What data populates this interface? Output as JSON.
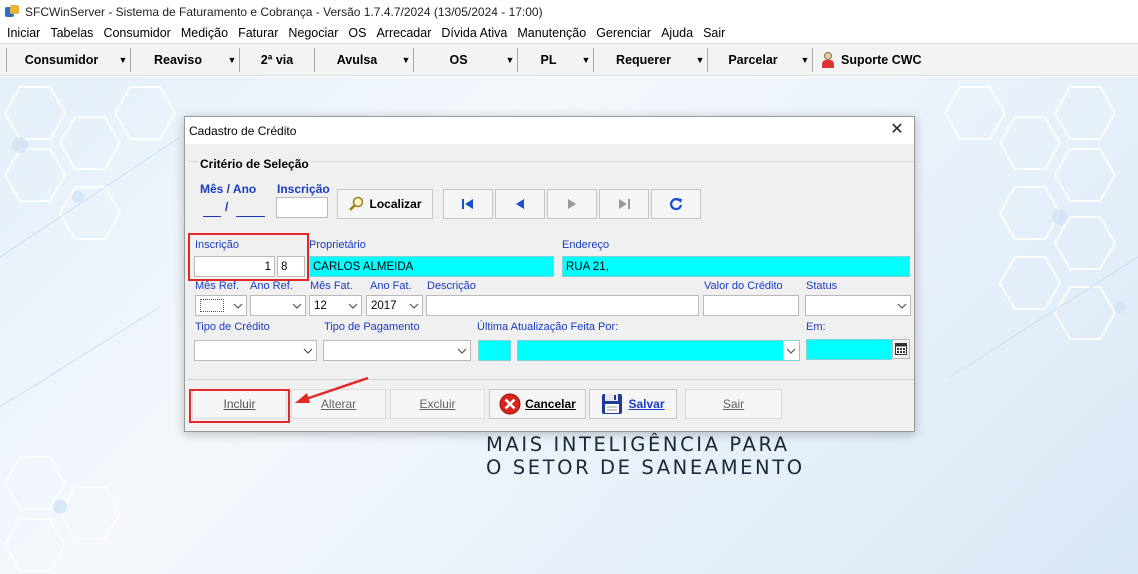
{
  "window": {
    "title": "SFCWinServer - Sistema de Faturamento e Cobrança - Versão 1.7.4.7/2024 (13/05/2024 - 17:00)"
  },
  "menu": [
    "Iniciar",
    "Tabelas",
    "Consumidor",
    "Medição",
    "Faturar",
    "Negociar",
    "OS",
    "Arrecadar",
    "Dívida Ativa",
    "Manutenção",
    "Gerenciar",
    "Ajuda",
    "Sair"
  ],
  "toolbar": {
    "buttons": [
      "Consumidor",
      "Reaviso",
      "2ª via",
      "Avulsa",
      "OS",
      "PL",
      "Requerer",
      "Parcelar"
    ],
    "support": "Suporte CWC"
  },
  "slogan": {
    "line1": "MAIS INTELIGÊNCIA PARA",
    "line2": "O SETOR DE SANEAMENTO"
  },
  "dialog": {
    "title": "Cadastro de Crédito",
    "criteria": {
      "legend": "Critério de Seleção",
      "mes_ano_label": "Mês / Ano",
      "slash": "/",
      "inscricao_label": "Inscrição",
      "localizar": "Localizar"
    },
    "form": {
      "inscricao_label": "Inscrição",
      "inscricao_value": "1",
      "inscricao_dv": "8",
      "proprietario_label": "Proprietário",
      "proprietario_value": "CARLOS ALMEIDA",
      "endereco_label": "Endereço",
      "endereco_value": "RUA 21,",
      "mes_ref_label": "Mês Ref.",
      "ano_ref_label": "Ano Ref.",
      "mes_fat_label": "Mês Fat.",
      "mes_fat_value": "12",
      "ano_fat_label": "Ano Fat.",
      "ano_fat_value": "2017",
      "descricao_label": "Descrição",
      "valor_credito_label": "Valor do Crédito",
      "status_label": "Status",
      "tipo_credito_label": "Tipo de Crédito",
      "tipo_pagamento_label": "Tipo de Pagamento",
      "ultima_atualizacao_label": "Última Atualização Feita Por:",
      "em_label": "Em:"
    },
    "actions": {
      "incluir": "Incluir",
      "alterar": "Alterar",
      "excluir": "Excluir",
      "cancelar": "Cancelar",
      "salvar": "Salvar",
      "sair": "Sair"
    }
  },
  "colors": {
    "highlight": "#00ffff",
    "annotation": "#e32828",
    "label_blue": "#1a3cbf"
  }
}
